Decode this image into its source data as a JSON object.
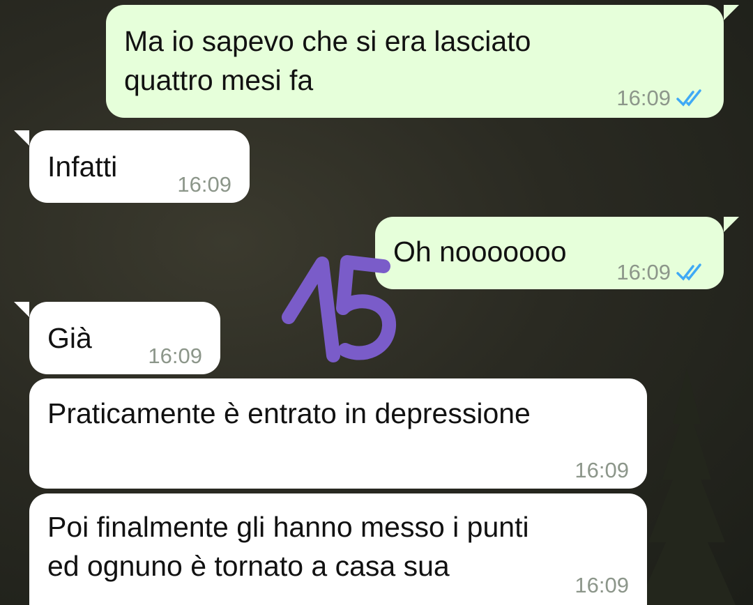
{
  "messages": [
    {
      "id": "m1",
      "direction": "outgoing",
      "text": "Ma io sapevo che si era lasciato\nquattro mesi fa",
      "time": "16:09",
      "status": "read-double-check"
    },
    {
      "id": "m2",
      "direction": "incoming",
      "text": "Infatti",
      "time": "16:09"
    },
    {
      "id": "m3",
      "direction": "outgoing",
      "text": "Oh nooooooo",
      "time": "16:09",
      "status": "read-double-check"
    },
    {
      "id": "m4",
      "direction": "incoming",
      "text": "Già",
      "time": "16:09"
    },
    {
      "id": "m5",
      "direction": "incoming",
      "text": "Praticamente è entrato in depressione",
      "time": "16:09"
    },
    {
      "id": "m6",
      "direction": "incoming",
      "text": "Poi finalmente gli hanno messo i punti\ned ognuno è tornato a casa sua",
      "time": "16:09"
    }
  ],
  "annotation": {
    "text": "15",
    "color": "#7a5cc9"
  },
  "colors": {
    "outgoing_bubble": "#e6ffda",
    "incoming_bubble": "#ffffff",
    "read_check": "#3fa9f5",
    "meta_text": "#8c968a"
  }
}
